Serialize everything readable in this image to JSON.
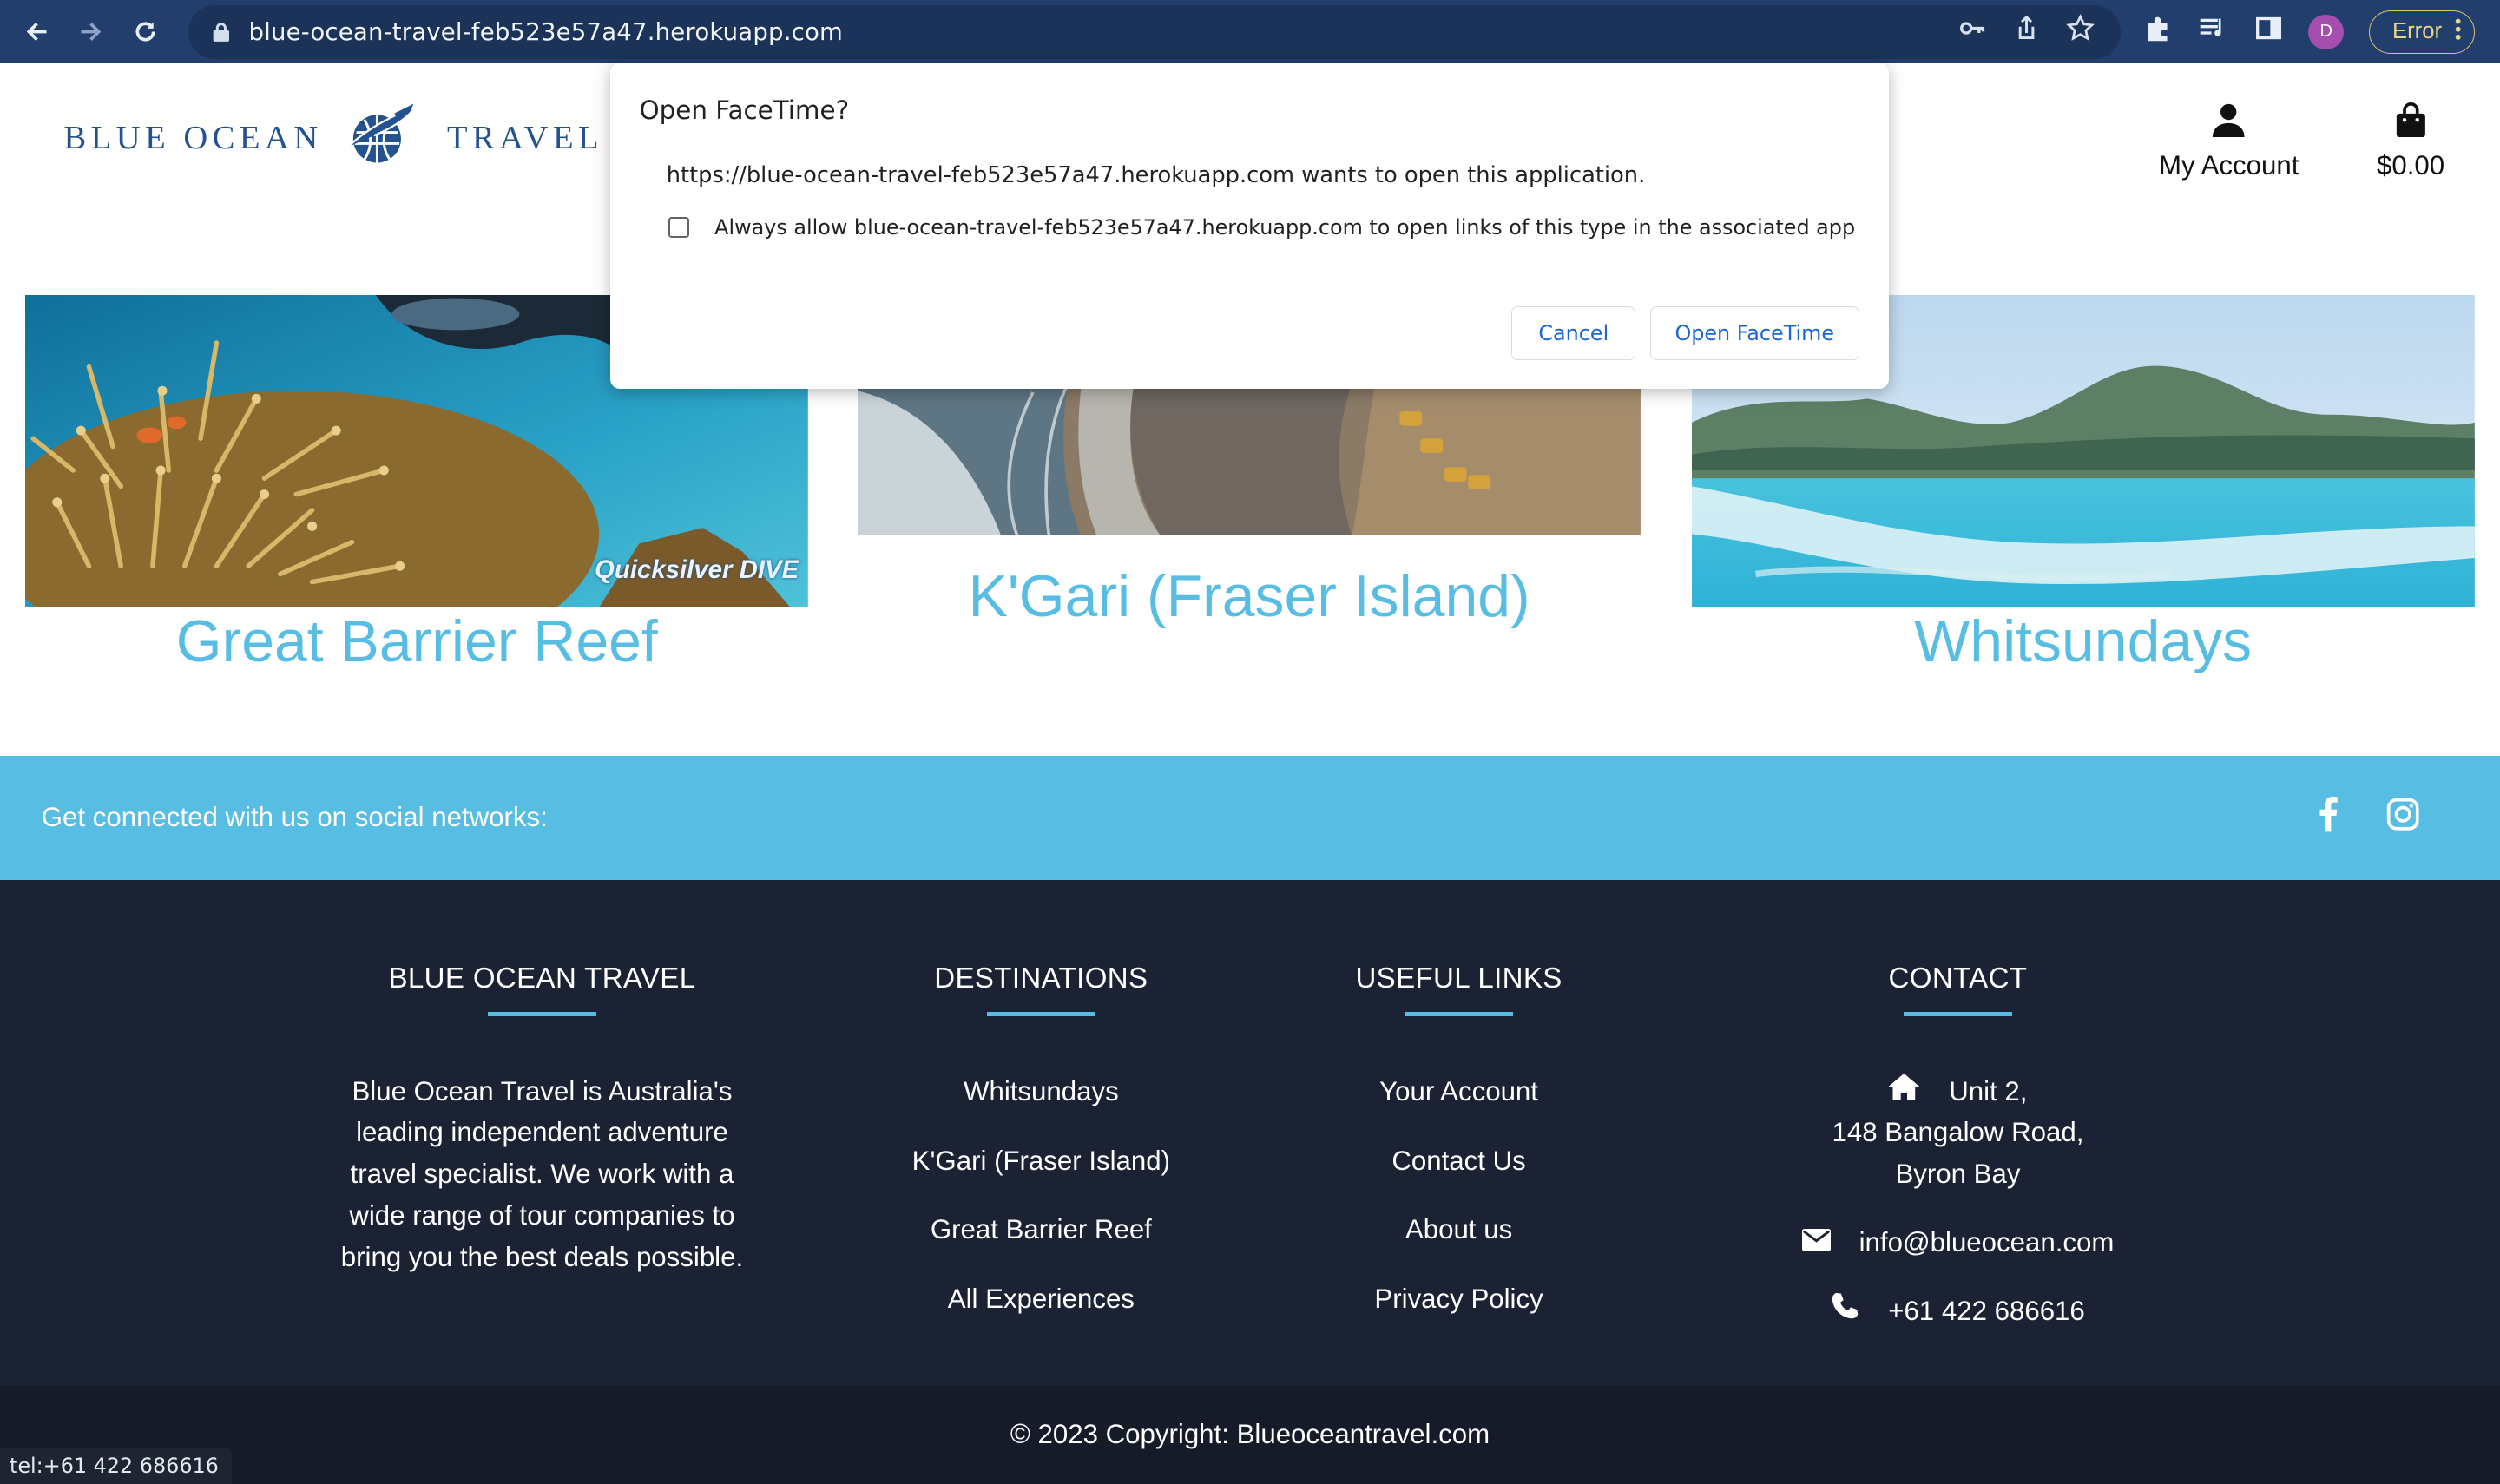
{
  "browser": {
    "url": "blue-ocean-travel-feb523e57a47.herokuapp.com",
    "profile_initial": "D",
    "error_label": "Error",
    "icons": [
      "back-icon",
      "forward-icon",
      "reload-icon",
      "lock-icon",
      "key-icon",
      "share-icon",
      "star-icon",
      "extensions-icon",
      "media-icon",
      "side-panel-icon",
      "kebab-menu-icon"
    ]
  },
  "header": {
    "logo_word1": "BLUE OCEAN",
    "logo_word2": "TRAVEL",
    "account_label": "My Account",
    "cart_total": "$0.00"
  },
  "destinations": [
    {
      "title": "Great Barrier Reef",
      "watermark": "Quicksilver DIVE"
    },
    {
      "title": "K'Gari (Fraser Island)"
    },
    {
      "title": "Whitsundays"
    }
  ],
  "social": {
    "text": "Get connected with us on social networks:",
    "icons": [
      "facebook-icon",
      "instagram-icon"
    ]
  },
  "footer": {
    "about": {
      "heading": "BLUE OCEAN TRAVEL",
      "lines": [
        "Blue Ocean Travel is Australia's",
        "leading independent adventure",
        "travel specialist. We work with a",
        "wide range of tour companies to",
        "bring you the best deals possible."
      ]
    },
    "destinations": {
      "heading": "DESTINATIONS",
      "links": [
        "Whitsundays",
        "K'Gari (Fraser Island)",
        "Great Barrier Reef",
        "All Experiences"
      ]
    },
    "useful": {
      "heading": "USEFUL LINKS",
      "links": [
        "Your Account",
        "Contact Us",
        "About us",
        "Privacy Policy"
      ]
    },
    "contact": {
      "heading": "CONTACT",
      "address": [
        "Unit 2,",
        "148 Bangalow Road,",
        "Byron Bay"
      ],
      "email": "info@blueocean.com",
      "phone": "+61 422 686616"
    },
    "copyright": "© 2023 Copyright: Blueoceantravel.com"
  },
  "status_tooltip": "tel:+61 422 686616",
  "dialog": {
    "title": "Open FaceTime?",
    "message": "https://blue-ocean-travel-feb523e57a47.herokuapp.com wants to open this application.",
    "checkbox_label": "Always allow blue-ocean-travel-feb523e57a47.herokuapp.com to open links of this type in the associated app",
    "checkbox_checked": false,
    "cancel_label": "Cancel",
    "open_label": "Open FaceTime",
    "accent": "#1a66d2"
  },
  "colors": {
    "brand_blue": "#24528f",
    "accent_cyan": "#58bde3",
    "footer_bg": "#1b2233",
    "chrome_bg": "#213e6c"
  }
}
